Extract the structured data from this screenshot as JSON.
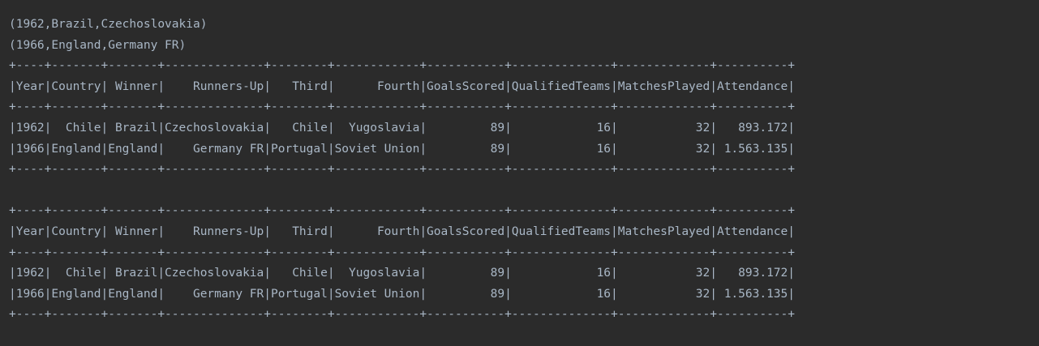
{
  "console": {
    "lines": [
      "(1962,Brazil,Czechoslovakia)",
      "(1966,England,Germany FR)",
      "+----+-------+-------+--------------+--------+------------+-----------+--------------+-------------+----------+",
      "|Year|Country| Winner|    Runners-Up|   Third|      Fourth|GoalsScored|QualifiedTeams|MatchesPlayed|Attendance|",
      "+----+-------+-------+--------------+--------+------------+-----------+--------------+-------------+----------+",
      "|1962|  Chile| Brazil|Czechoslovakia|   Chile|  Yugoslavia|         89|            16|           32|   893.172|",
      "|1966|England|England|    Germany FR|Portugal|Soviet Union|         89|            16|           32| 1.563.135|",
      "+----+-------+-------+--------------+--------+------------+-----------+--------------+-------------+----------+",
      "",
      "+----+-------+-------+--------------+--------+------------+-----------+--------------+-------------+----------+",
      "|Year|Country| Winner|    Runners-Up|   Third|      Fourth|GoalsScored|QualifiedTeams|MatchesPlayed|Attendance|",
      "+----+-------+-------+--------------+--------+------------+-----------+--------------+-------------+----------+",
      "|1962|  Chile| Brazil|Czechoslovakia|   Chile|  Yugoslavia|         89|            16|           32|   893.172|",
      "|1966|England|England|    Germany FR|Portugal|Soviet Union|         89|            16|           32| 1.563.135|",
      "+----+-------+-------+--------------+--------+------------+-----------+--------------+-------------+----------+"
    ]
  }
}
